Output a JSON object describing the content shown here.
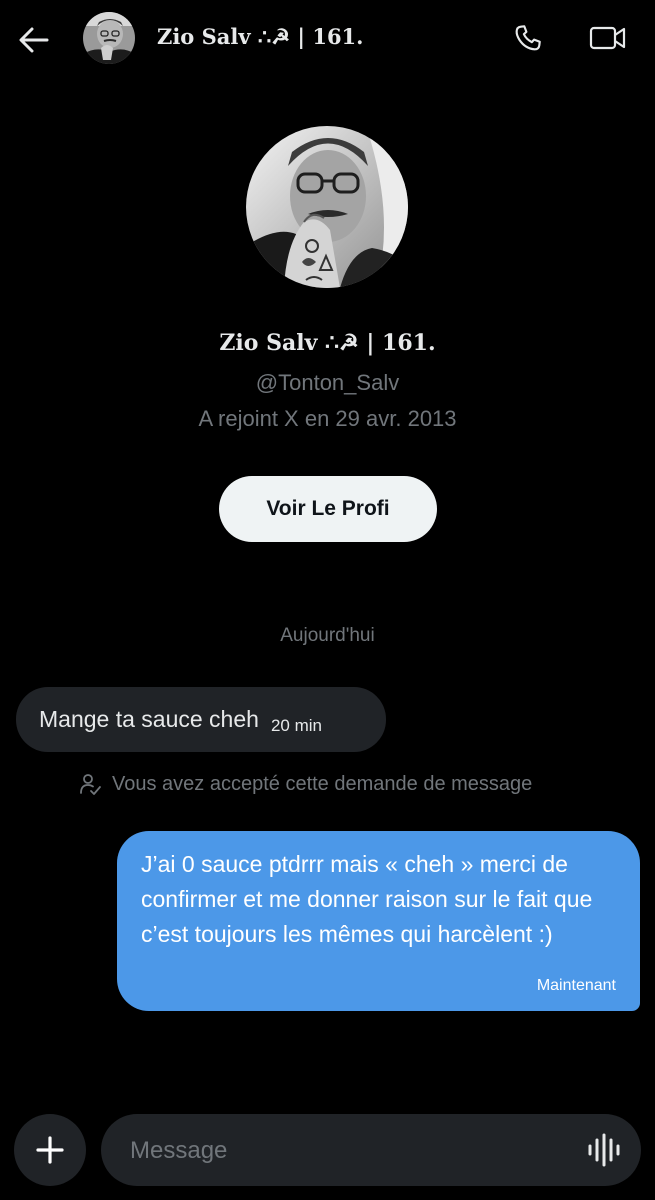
{
  "header": {
    "name": "Zio Salv ∴☭ | 161.",
    "back_icon": "arrow-left-icon",
    "call_icon": "phone-icon",
    "video_icon": "video-camera-icon"
  },
  "profile": {
    "name": "Zio Salv ∴☭ | 161.",
    "handle": "@Tonton_Salv",
    "joined": "A rejoint X en 29 avr. 2013",
    "button_label": "Voir Le Profi"
  },
  "conversation": {
    "date_separator": "Aujourd'hui",
    "messages": [
      {
        "direction": "incoming",
        "text": "Mange ta sauce cheh",
        "time": "20 min"
      },
      {
        "direction": "outgoing",
        "text": "J’ai 0 sauce ptdrrr mais « cheh » merci de confirmer et me donner raison sur le fait que c’est toujours les mêmes qui harcèlent :)",
        "time": "Maintenant"
      }
    ],
    "request_notice": "Vous avez accepté cette demande de message"
  },
  "composer": {
    "placeholder": "Message",
    "add_icon": "plus-icon",
    "voice_icon": "voice-waveform-icon"
  },
  "colors": {
    "background": "#000000",
    "incoming_bubble": "#202327",
    "outgoing_bubble": "#4c98e8",
    "secondary_text": "#71767b",
    "button_bg": "#eff3f4"
  }
}
